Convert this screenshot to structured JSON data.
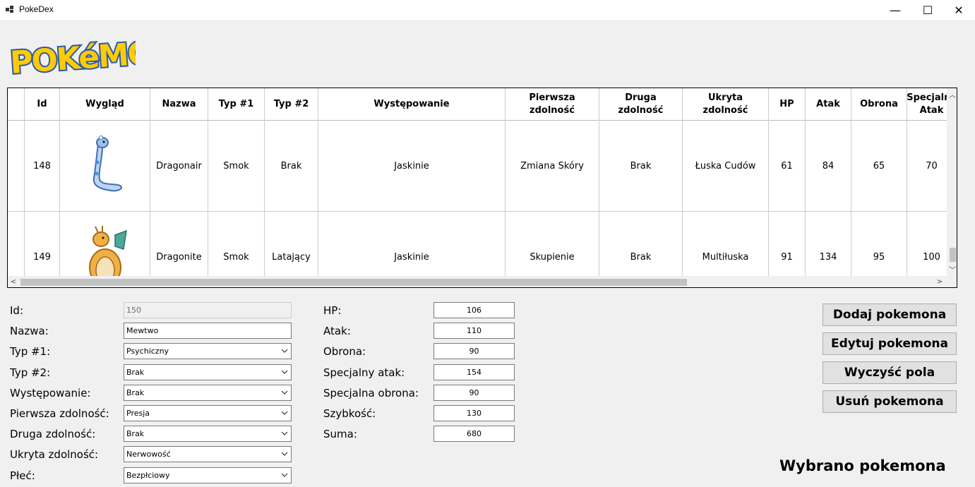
{
  "window": {
    "title": "PokeDex",
    "minimize": "—",
    "maximize": "☐",
    "close": "✕"
  },
  "logo": {
    "text": "POKéMON",
    "colors": {
      "fill": "#ffcb05",
      "stroke": "#2a5aa8"
    }
  },
  "table": {
    "columns": [
      {
        "label": "Id"
      },
      {
        "label": "Wygląd"
      },
      {
        "label": "Nazwa"
      },
      {
        "label": "Typ #1"
      },
      {
        "label": "Typ #2"
      },
      {
        "label": "Występowanie"
      },
      {
        "label": "Pierwsza zdolność"
      },
      {
        "label": "Druga zdolność"
      },
      {
        "label": "Ukryta zdolność"
      },
      {
        "label": "HP"
      },
      {
        "label": "Atak"
      },
      {
        "label": "Obrona"
      },
      {
        "label": "Specjalny Atak"
      }
    ],
    "rows": [
      {
        "id": "148",
        "image": "dragonair-sprite",
        "name": "Dragonair",
        "type1": "Smok",
        "type2": "Brak",
        "habitat": "Jaskinie",
        "ability1": "Zmiana Skóry",
        "ability2": "Brak",
        "hidden": "Łuska Cudów",
        "hp": "61",
        "atk": "84",
        "def": "65",
        "spatk": "70"
      },
      {
        "id": "149",
        "image": "dragonite-sprite",
        "name": "Dragonite",
        "type1": "Smok",
        "type2": "Latający",
        "habitat": "Jaskinie",
        "ability1": "Skupienie",
        "ability2": "Brak",
        "hidden": "Multiłuska",
        "hp": "91",
        "atk": "134",
        "def": "95",
        "spatk": "100"
      }
    ]
  },
  "form": {
    "left": [
      {
        "label": "Id:",
        "value": "150",
        "kind": "text-disabled"
      },
      {
        "label": "Nazwa:",
        "value": "Mewtwo",
        "kind": "text"
      },
      {
        "label": "Typ #1:",
        "value": "Psychiczny",
        "kind": "combo"
      },
      {
        "label": "Typ #2:",
        "value": "Brak",
        "kind": "combo"
      },
      {
        "label": "Występowanie:",
        "value": "Brak",
        "kind": "combo"
      },
      {
        "label": "Pierwsza zdolność:",
        "value": "Presja",
        "kind": "combo"
      },
      {
        "label": "Druga zdolność:",
        "value": "Brak",
        "kind": "combo"
      },
      {
        "label": "Ukryta zdolność:",
        "value": "Nerwowość",
        "kind": "combo"
      },
      {
        "label": "Płeć:",
        "value": "Bezpłciowy",
        "kind": "combo"
      }
    ],
    "right": [
      {
        "label": "HP:",
        "value": "106"
      },
      {
        "label": "Atak:",
        "value": "110"
      },
      {
        "label": "Obrona:",
        "value": "90"
      },
      {
        "label": "Specjalny atak:",
        "value": "154"
      },
      {
        "label": "Specjalna obrona:",
        "value": "90"
      },
      {
        "label": "Szybkość:",
        "value": "130"
      },
      {
        "label": "Suma:",
        "value": "680"
      }
    ]
  },
  "buttons": {
    "add": "Dodaj pokemona",
    "edit": "Edytuj pokemona",
    "clear": "Wyczyść pola",
    "delete": "Usuń pokemona"
  },
  "status": "Wybrano pokemona"
}
